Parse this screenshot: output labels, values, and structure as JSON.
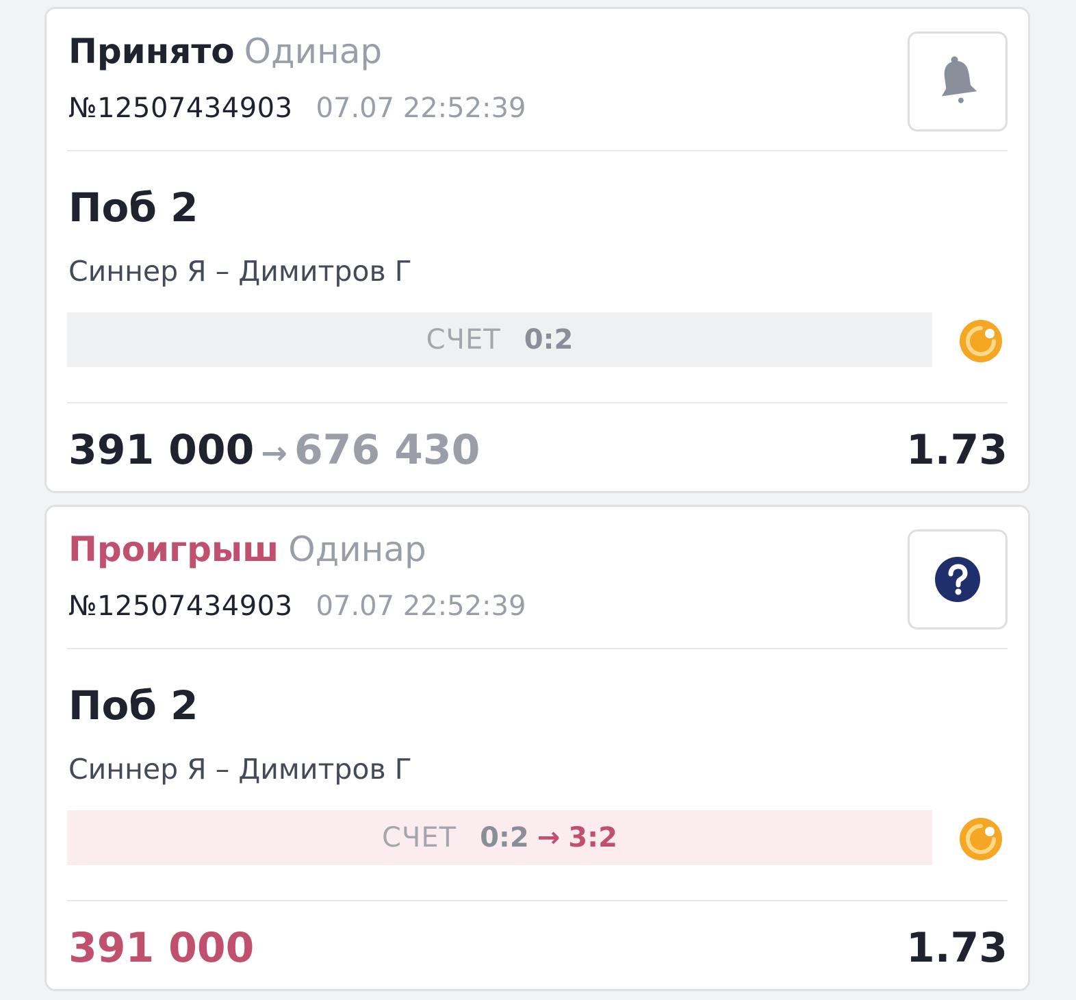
{
  "bets": [
    {
      "status": "Принято",
      "bet_type": "Одинар",
      "number": "№12507434903",
      "datetime": "07.07 22:52:39",
      "action_icon": "bell-icon",
      "outcome": "Поб 2",
      "event": "Синнер Я – Димитров Г",
      "score_label": "СЧЕТ",
      "score": "0:2",
      "score_arrow": "",
      "score_new": "",
      "live_icon": "live-indicator-icon",
      "stake": "391 000",
      "amount_arrow": "→",
      "payout": "676 430",
      "odds": "1.73"
    },
    {
      "status": "Проигрыш",
      "bet_type": "Одинар",
      "number": "№12507434903",
      "datetime": "07.07 22:52:39",
      "action_icon": "question-icon",
      "outcome": "Поб 2",
      "event": "Синнер Я – Димитров Г",
      "score_label": "СЧЕТ",
      "score": "0:2",
      "score_arrow": "→",
      "score_new": "3:2",
      "live_icon": "live-indicator-icon",
      "stake": "391 000",
      "amount_arrow": "",
      "payout": "",
      "odds": "1.73"
    }
  ],
  "colors": {
    "accent_lost": "#c0506e",
    "muted_text": "#9a9ea8",
    "live_orange": "#f5a623",
    "question_navy": "#1f2f6b"
  }
}
